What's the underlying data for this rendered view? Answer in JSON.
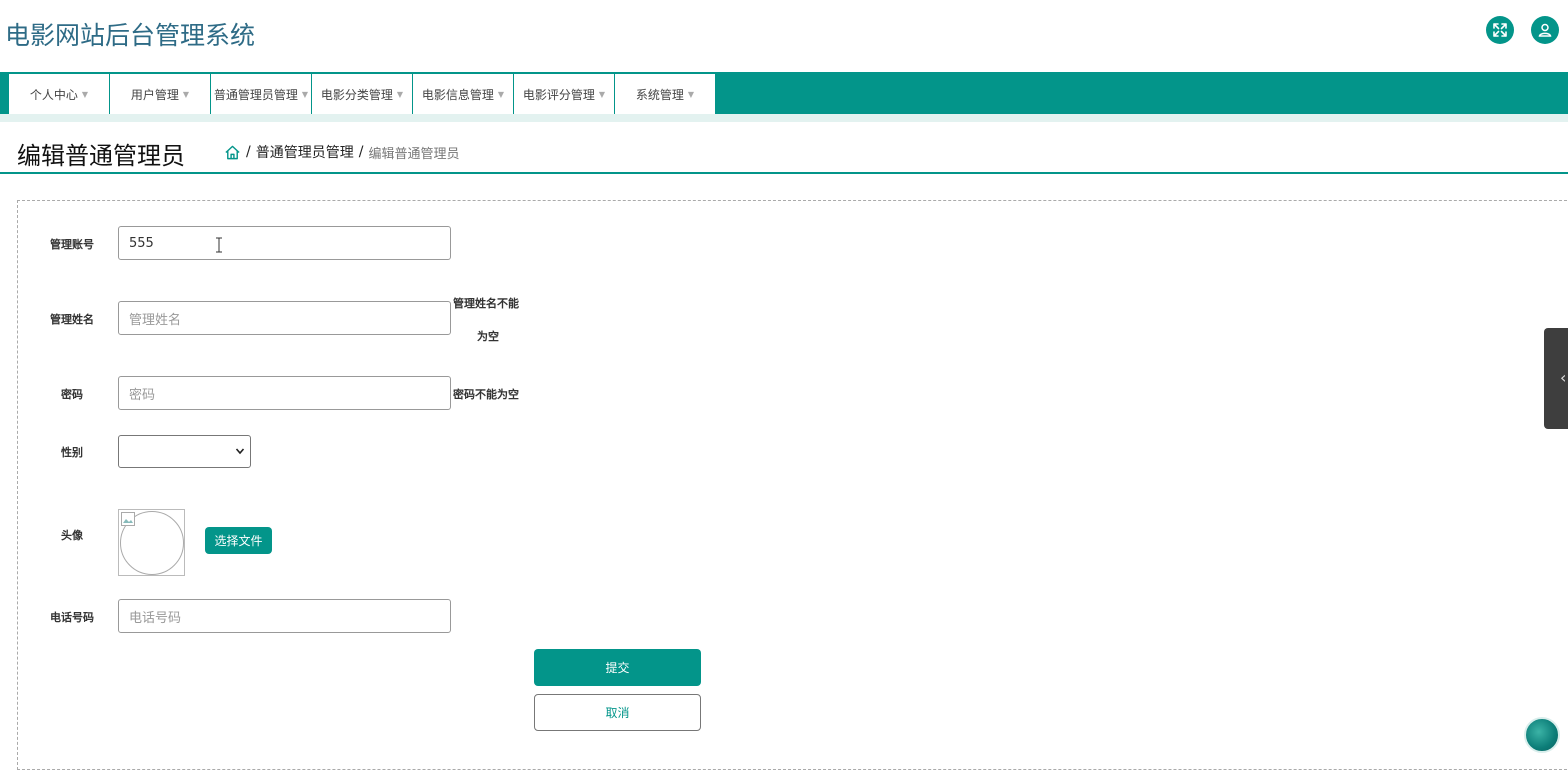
{
  "header": {
    "title": "电影网站后台管理系统",
    "fullscreen_icon": "expand-arrows-icon",
    "user_icon": "user-icon"
  },
  "nav": {
    "items": [
      {
        "label": "个人中心"
      },
      {
        "label": "用户管理"
      },
      {
        "label": "普通管理员管理"
      },
      {
        "label": "电影分类管理"
      },
      {
        "label": "电影信息管理"
      },
      {
        "label": "电影评分管理"
      },
      {
        "label": "系统管理"
      }
    ]
  },
  "page": {
    "title": "编辑普通管理员",
    "breadcrumb": {
      "home_icon": "home-icon",
      "sep": "/",
      "level1": "普通管理员管理",
      "current": "编辑普通管理员"
    }
  },
  "form": {
    "account": {
      "label": "管理账号",
      "value": "555"
    },
    "name": {
      "label": "管理姓名",
      "placeholder": "管理姓名",
      "error_line1": "管理姓名不能",
      "error_line2": "为空"
    },
    "password": {
      "label": "密码",
      "placeholder": "密码",
      "error": "密码不能为空"
    },
    "gender": {
      "label": "性别",
      "value": ""
    },
    "avatar": {
      "label": "头像",
      "choose_file": "选择文件"
    },
    "phone": {
      "label": "电话号码",
      "placeholder": "电话号码"
    },
    "submit": "提交",
    "cancel": "取消"
  },
  "colors": {
    "primary": "#03958a",
    "title": "#2e6b86"
  }
}
